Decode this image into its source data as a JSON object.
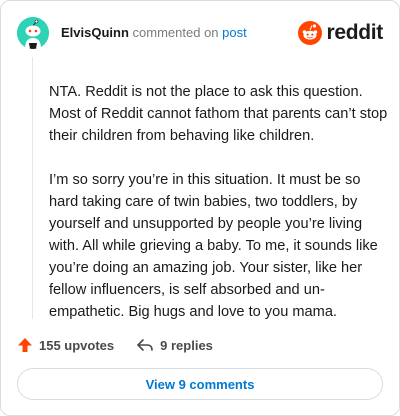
{
  "header": {
    "username": "ElvisQuinn",
    "action_text": "commented on",
    "target_link": "post",
    "brand_name": "reddit"
  },
  "comment": {
    "paragraphs": [
      "NTA. Reddit is not the place to ask this question. Most of Reddit cannot fathom that parents can’t stop their children from behaving like children.",
      "I’m so sorry you’re in this situation. It must be so hard taking care of twin babies, two toddlers, by yourself and unsupported by people you’re living with. All while grieving a baby. To me, it sounds like you’re doing an amazing job. Your sister, like her fellow influencers, is self absorbed and un-empathetic. Big hugs and love to you mama."
    ]
  },
  "actions": {
    "upvotes_label": "155 upvotes",
    "replies_label": "9 replies"
  },
  "view_comments_label": "View 9 comments",
  "colors": {
    "accent": "#ff4500",
    "link": "#0079d3",
    "avatar_bg": "#2ed3b5"
  }
}
